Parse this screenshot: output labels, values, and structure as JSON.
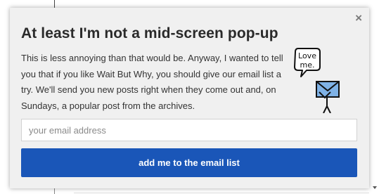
{
  "popup": {
    "close_label": "×",
    "title": "At least I'm not a mid-screen pop-up",
    "body": "This is less annoying than that would be. Anyway, I wanted to tell you that if you like Wait But Why, you should give our email list a try. We'll send you new posts right when they come out and, on Sundays, a popular post from the archives.",
    "illustration": {
      "speech_text": "Love me.",
      "icon": "stick-figure-holding-envelope"
    },
    "email_placeholder": "your email address",
    "email_value": "",
    "submit_label": "add me to the email list"
  },
  "colors": {
    "popup_bg": "#f0f0f0",
    "button_bg": "#1a56b8",
    "button_text": "#ffffff",
    "title_text": "#2a2a2a"
  }
}
